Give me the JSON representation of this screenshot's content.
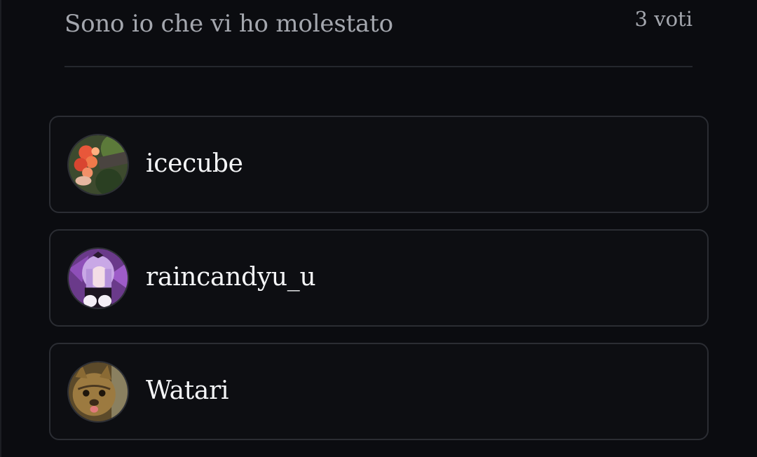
{
  "poll_option": {
    "title": "Sono io che vi ho molestato",
    "vote_count": "3 voti"
  },
  "voters": [
    {
      "name": "icecube",
      "avatar_icon": "flower-photo-avatar"
    },
    {
      "name": "raincandyu_u",
      "avatar_icon": "anime-girl-avatar"
    },
    {
      "name": "Watari",
      "avatar_icon": "cat-photo-avatar"
    }
  ],
  "colors": {
    "background": "#0b0c10",
    "card_border": "#2b2d33",
    "muted_text": "#a4a7ae",
    "primary_text": "#f4f5f7"
  }
}
